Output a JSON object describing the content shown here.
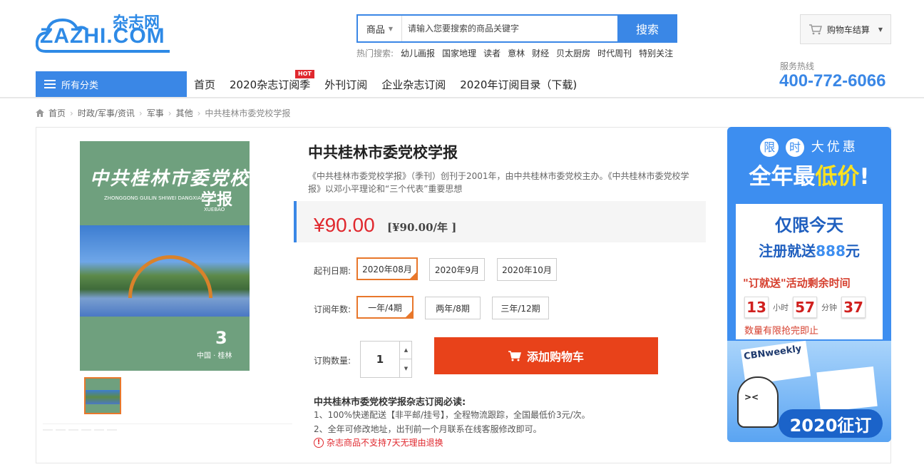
{
  "header": {
    "logo": {
      "brand": "ZAZHI.COM",
      "cn": "杂志网"
    },
    "search": {
      "category": "商品",
      "placeholder": "请输入您要搜索的商品关键字",
      "button": "搜索"
    },
    "hot_search": {
      "label": "热门搜索:",
      "keywords": [
        "幼儿画报",
        "国家地理",
        "读者",
        "意林",
        "财经",
        "贝太厨房",
        "时代周刊",
        "特别关注"
      ]
    },
    "cart": {
      "label": "购物车结算",
      "icon": "cart-icon"
    },
    "service": {
      "label": "服务热线",
      "phone": "400-772-6066"
    }
  },
  "nav": {
    "all_categories": "所有分类",
    "items": [
      "首页",
      "2020杂志订阅季",
      "外刊订阅",
      "企业杂志订阅",
      "2020年订阅目录（下载)"
    ],
    "hot_badge": "HOT"
  },
  "breadcrumb": [
    "首页",
    "时政/军事/资讯",
    "军事",
    "其他",
    "中共桂林市委党校学报"
  ],
  "product": {
    "cover": {
      "title": "中共桂林市委党校",
      "pinyin": "ZHONGGONG GUILIN SHIWEI DANGXIAO",
      "xuebao": "学报",
      "xuebao_pinyin": "XUEBAO",
      "issue": "3",
      "city": "中国 · 桂林"
    },
    "title": "中共桂林市委党校学报",
    "description": "《中共桂林市委党校学报》（季刊）创刊于2001年，由中共桂林市委党校主办。《中共桂林市委党校学报》以邓小平理论和“三个代表”重要思想",
    "price": "¥90.00",
    "price_per_year": "[¥90.00/年 ]",
    "start_date": {
      "label": "起刊日期:",
      "options": [
        "2020年08月",
        "2020年9月",
        "2020年10月"
      ],
      "selected": "2020年08月"
    },
    "duration": {
      "label": "订阅年数:",
      "options": [
        "一年/4期",
        "两年/8期",
        "三年/12期"
      ],
      "selected": "一年/4期"
    },
    "quantity": {
      "label": "订购数量:",
      "value": "1"
    },
    "add_to_cart": "添加购物车",
    "notes": {
      "title": "中共桂林市委党校学报杂志订阅必读:",
      "items": [
        "1、100%快递配送【非平邮/挂号】，全程物流跟踪，全国最低价3元/次。",
        "2、全年可修改地址，出刊前一个月联系在线客服修改即可。"
      ],
      "warning": "杂志商品不支持7天无理由退换"
    }
  },
  "promo": {
    "line1": [
      "限",
      "时",
      "大",
      "优",
      "惠"
    ],
    "line2_a": "全年最",
    "line2_b": "低价",
    "line2_c": "!",
    "today": "仅限今天",
    "register_a": "注册就送",
    "register_b": "888",
    "register_c": "元",
    "activity": "\"订就送\"活动剩余时间",
    "countdown": {
      "hours": "13",
      "hours_unit": "小时",
      "minutes": "57",
      "minutes_unit": "分钟",
      "seconds": "37"
    },
    "limited": "数量有限抢完即止",
    "magazine_label": "CBNweekly",
    "badge": "2020征订"
  }
}
